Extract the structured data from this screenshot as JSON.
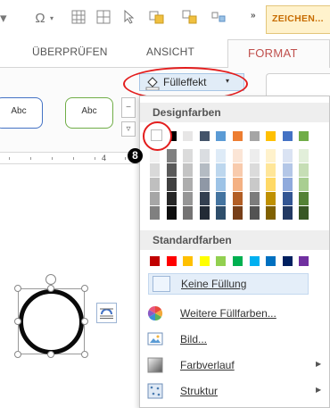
{
  "qat": {
    "buttons": [
      "omega-icon",
      "table-icon",
      "table-2-icon",
      "pointer-icon",
      "shape-arrange-icon",
      "group-icon"
    ],
    "more_label": "»",
    "contextual_tab_label": "ZEICHEN..."
  },
  "tabs": {
    "items": [
      "ÜBERPRÜFEN",
      "ANSICHT"
    ],
    "active": "FORMAT"
  },
  "ribbon": {
    "style_boxes": [
      "Abc",
      "Abc"
    ],
    "fill_button": "Fülleffekt",
    "fill_caret": "▾"
  },
  "ruler": {
    "number": "4"
  },
  "menu": {
    "theme_colors_header": "Designfarben",
    "standard_colors_header": "Standardfarben",
    "no_fill": "Keine Füllung",
    "more_colors": "Weitere Füllfarben...",
    "picture": "Bild...",
    "gradient": "Farbverlauf",
    "texture": "Struktur",
    "theme_colors": [
      "#ffffff",
      "#000000",
      "#e7e6e6",
      "#44546a",
      "#5b9bd5",
      "#ed7d31",
      "#a5a5a5",
      "#ffc000",
      "#4472c4",
      "#70ad47"
    ],
    "standard_colors": [
      "#c00000",
      "#ff0000",
      "#ffc000",
      "#ffff00",
      "#92d050",
      "#00b050",
      "#00b0f0",
      "#0070c0",
      "#002060",
      "#7030a0"
    ]
  },
  "callout": {
    "badge": "8"
  },
  "colors": {
    "accent": "#c0504d",
    "highlight_red": "#e31d1d",
    "contextual_orange": "#c76c00"
  }
}
